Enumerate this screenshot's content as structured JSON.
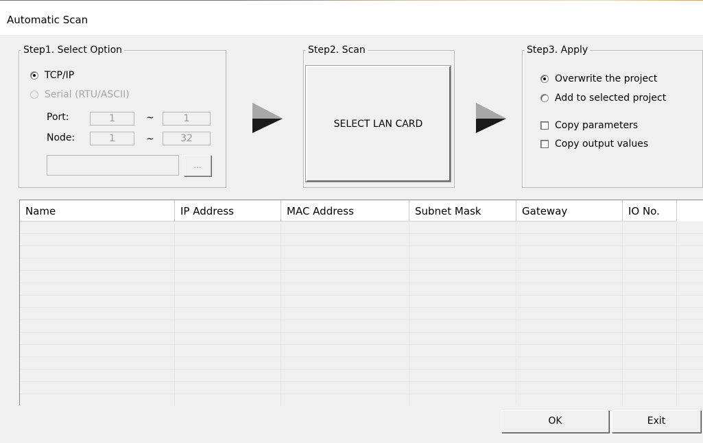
{
  "window": {
    "title": "Automatic Scan"
  },
  "step1": {
    "legend": "Step1. Select Option",
    "tcp_label": "TCP/IP",
    "serial_label": "Serial (RTU/ASCII)",
    "port_label": "Port:",
    "port_from": "1",
    "port_to": "1",
    "node_label": "Node:",
    "node_from": "1",
    "node_to": "32",
    "range_sep": "~",
    "path_value": "",
    "browse_label": "..."
  },
  "step2": {
    "legend": "Step2. Scan",
    "scan_button": "SELECT LAN CARD"
  },
  "step3": {
    "legend": "Step3. Apply",
    "overwrite_label": "Overwrite the project",
    "add_label": "Add to selected project",
    "copy_params_label": "Copy parameters",
    "copy_output_label": "Copy output values"
  },
  "table": {
    "columns": [
      "Name",
      "IP Address",
      "MAC Address",
      "Subnet Mask",
      "Gateway",
      "IO No."
    ],
    "rows": []
  },
  "buttons": {
    "ok": "OK",
    "exit": "Exit"
  },
  "icons": {
    "arrow": "play-arrow-icon"
  }
}
